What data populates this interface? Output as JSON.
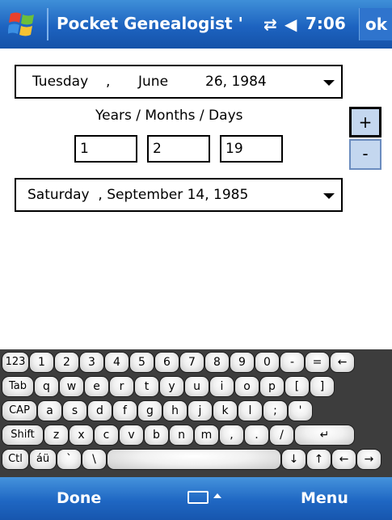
{
  "titlebar": {
    "title": "Pocket Genealogist '",
    "time": "7:06",
    "ok": "ok",
    "connectivity_icon": "sync-arrows-icon",
    "volume_icon": "speaker-icon"
  },
  "form": {
    "start_date": {
      "weekday": "Tuesday",
      "month": "June",
      "day_year": "26, 1984"
    },
    "duration_label": "Years / Months / Days",
    "years": "1",
    "months": "2",
    "days": "19",
    "plus": "+",
    "minus": "-",
    "end_date": "Saturday  , September 14, 1985"
  },
  "keyboard": {
    "rows": [
      [
        "123",
        "1",
        "2",
        "3",
        "4",
        "5",
        "6",
        "7",
        "8",
        "9",
        "0",
        "-",
        "=",
        "←"
      ],
      [
        "Tab",
        "q",
        "w",
        "e",
        "r",
        "t",
        "y",
        "u",
        "i",
        "o",
        "p",
        "[",
        "]"
      ],
      [
        "CAP",
        "a",
        "s",
        "d",
        "f",
        "g",
        "h",
        "j",
        "k",
        "l",
        ";",
        "'"
      ],
      [
        "Shift",
        "z",
        "x",
        "c",
        "v",
        "b",
        "n",
        "m",
        ",",
        ".",
        "/",
        "↵"
      ],
      [
        "Ctl",
        "áü",
        "`",
        "\\",
        "",
        "↓",
        "↑",
        "←",
        "→"
      ]
    ]
  },
  "menubar": {
    "left": "Done",
    "right": "Menu",
    "sip_icon": "keyboard-icon"
  },
  "colors": {
    "titlebar": "#1d63c0",
    "keyboard_bg": "#3d3d3d",
    "spin_bg": "#c4d7ef"
  }
}
